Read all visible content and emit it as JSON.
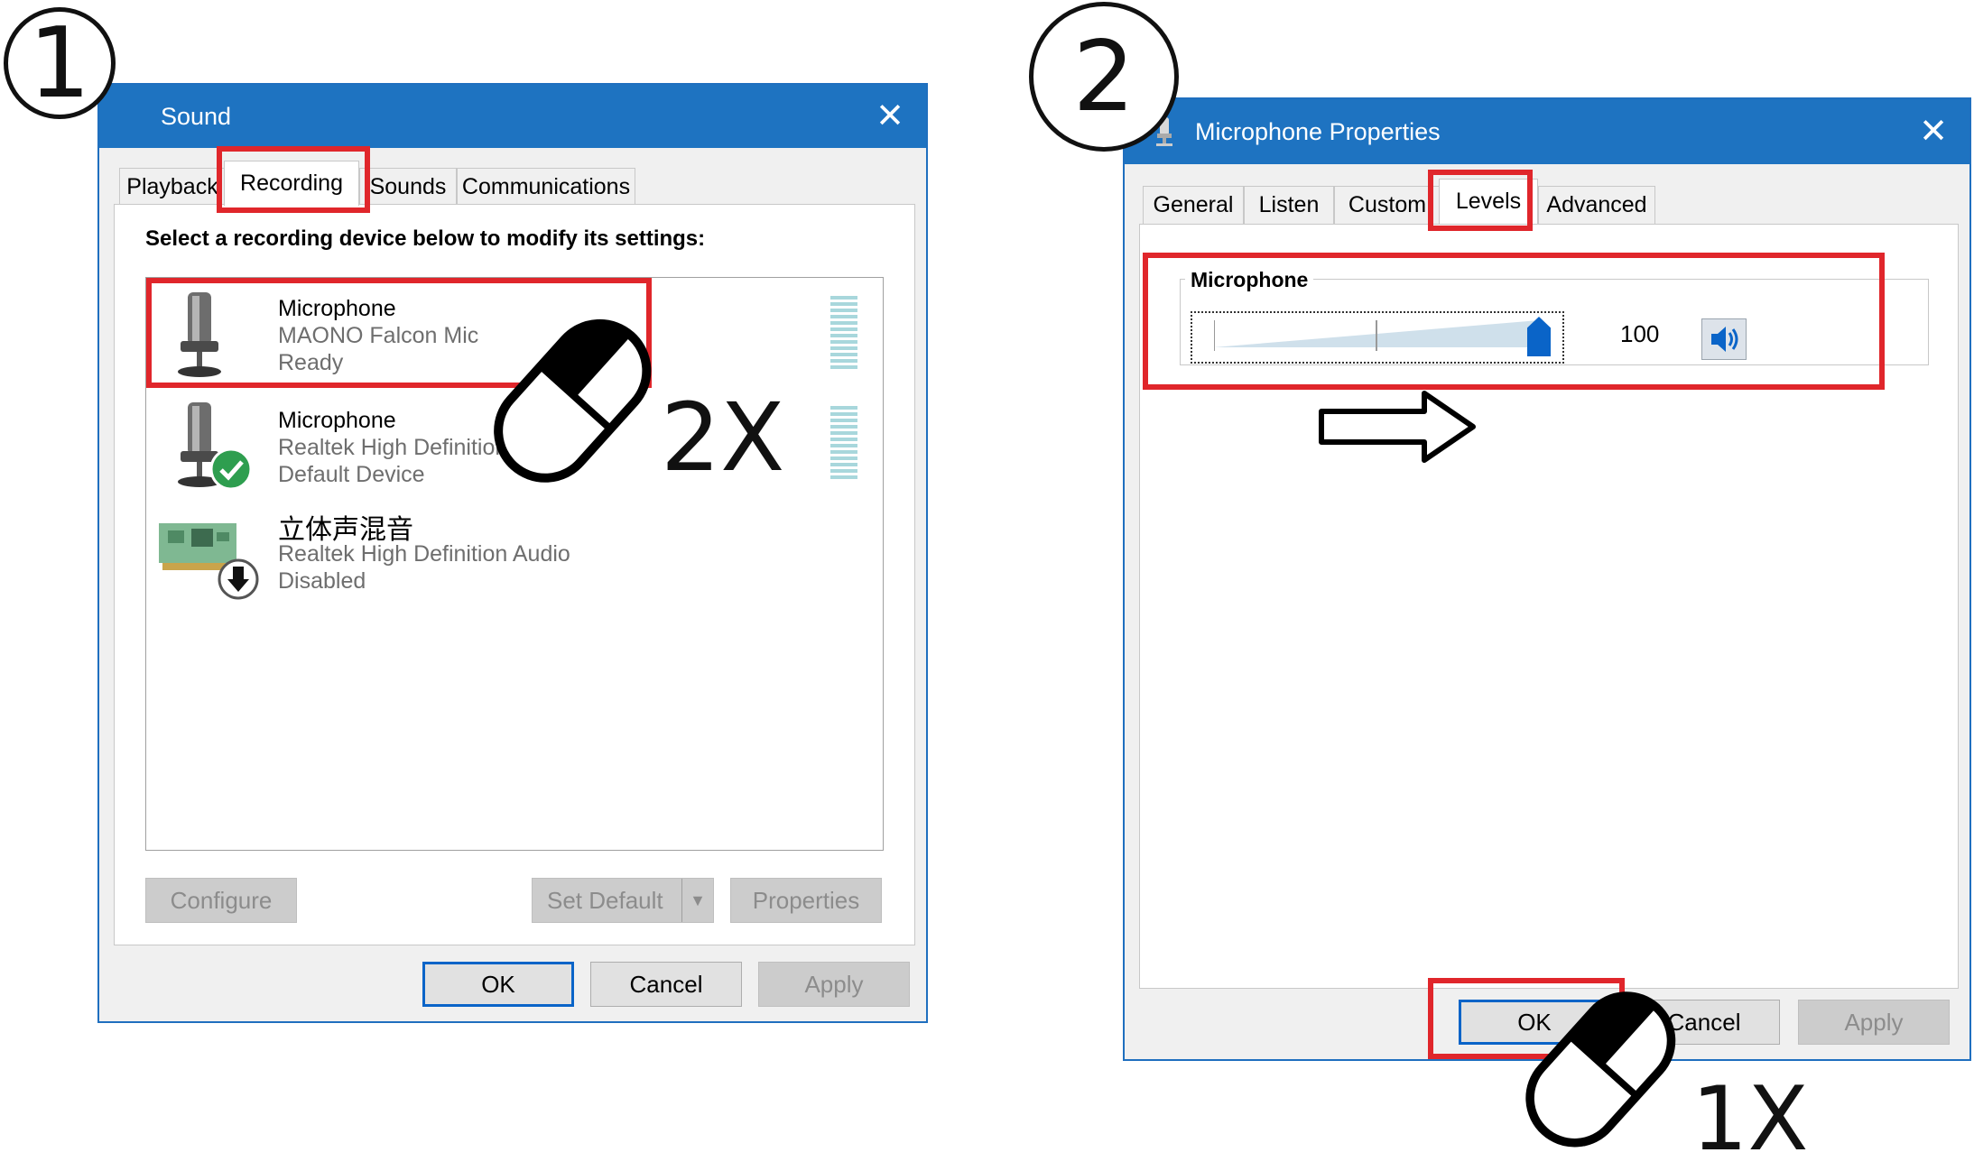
{
  "steps": {
    "one": "1",
    "two": "2"
  },
  "sound_dialog": {
    "title": "Sound",
    "tabs": [
      "Playback",
      "Recording",
      "Sounds",
      "Communications"
    ],
    "instruction": "Select a recording device below to modify its settings:",
    "devices": [
      {
        "name": "Microphone",
        "desc": "MAONO Falcon Mic",
        "status": "Ready"
      },
      {
        "name": "Microphone",
        "desc": "Realtek High Definition Audio",
        "status": "Default Device"
      },
      {
        "name": "立体声混音",
        "desc": "Realtek High Definition Audio",
        "status": "Disabled"
      }
    ],
    "buttons": {
      "configure": "Configure",
      "set_default": "Set Default",
      "properties": "Properties",
      "ok": "OK",
      "cancel": "Cancel",
      "apply": "Apply"
    }
  },
  "props_dialog": {
    "title": "Microphone Properties",
    "tabs": [
      "General",
      "Listen",
      "Custom",
      "Levels",
      "Advanced"
    ],
    "group_label": "Microphone",
    "level_value": "100",
    "level_fraction": 1.0,
    "buttons": {
      "ok": "OK",
      "cancel": "Cancel",
      "apply": "Apply"
    }
  },
  "annotations": {
    "double_click": "2X",
    "single_click": "1X"
  },
  "colors": {
    "titlebar": "#1e73c1",
    "highlight": "#e0262b",
    "accent": "#0a64c8"
  }
}
